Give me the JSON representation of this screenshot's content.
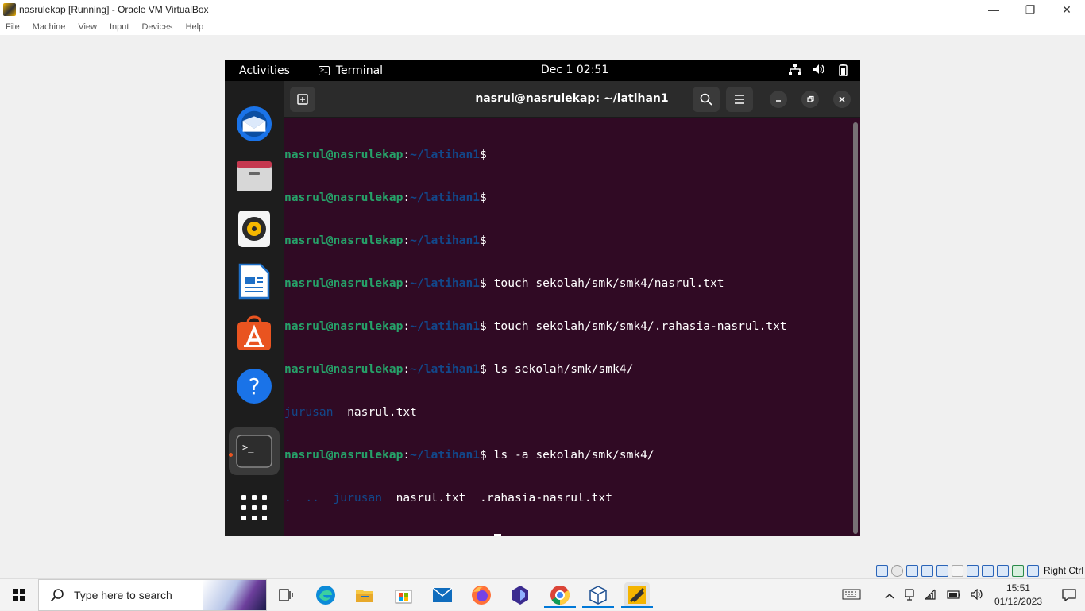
{
  "host": {
    "window_title": "nasrulekap [Running] - Oracle VM VirtualBox",
    "window_buttons": {
      "minimize": "—",
      "restore": "❐",
      "close": "✕"
    },
    "menu": [
      "File",
      "Machine",
      "View",
      "Input",
      "Devices",
      "Help"
    ],
    "status_label": "Right Ctrl"
  },
  "guest": {
    "topbar": {
      "activities": "Activities",
      "app_name": "Terminal",
      "clock": "Dec 1  02:51"
    },
    "dock": {
      "items": [
        "thunderbird-icon",
        "files-icon",
        "rhythmbox-icon",
        "writer-icon",
        "software-icon",
        "help-icon",
        "terminal-icon",
        "show-apps-icon"
      ]
    },
    "terminal": {
      "title": "nasrul@nasrulekap: ~/latihan1",
      "prompt_user": "nasrul@nasrulekap",
      "prompt_sep": ":",
      "prompt_path": "~/latihan1",
      "prompt_sym": "$",
      "lines": [
        {
          "cmd": ""
        },
        {
          "cmd": ""
        },
        {
          "cmd": ""
        },
        {
          "cmd": " touch sekolah/smk/smk4/nasrul.txt"
        },
        {
          "cmd": " touch sekolah/smk/smk4/.rahasia-nasrul.txt"
        },
        {
          "cmd": " ls sekolah/smk/smk4/"
        }
      ],
      "output1": {
        "dir": "jurusan",
        "file": "  nasrul.txt"
      },
      "line_ls_a": " ls -a sekolah/smk/smk4/",
      "output2": {
        "dots": ".  ..  ",
        "dir": "jurusan",
        "files": "  nasrul.txt  .rahasia-nasrul.txt"
      },
      "last_prompt_tail": " "
    }
  },
  "taskbar": {
    "search_placeholder": "Type here to search",
    "apps": [
      "task-view-icon",
      "edge-icon",
      "file-explorer-icon",
      "store-icon",
      "mail-icon",
      "firefox-icon",
      "app-icon",
      "chrome-icon",
      "virtualbox-icon",
      "virtualbox-vm-icon"
    ],
    "time": "15:51",
    "date": "01/12/2023"
  },
  "colors": {
    "terminal_bg": "#300a24",
    "prompt_user": "#26a269",
    "prompt_path": "#12488b",
    "accent": "#e95420"
  }
}
